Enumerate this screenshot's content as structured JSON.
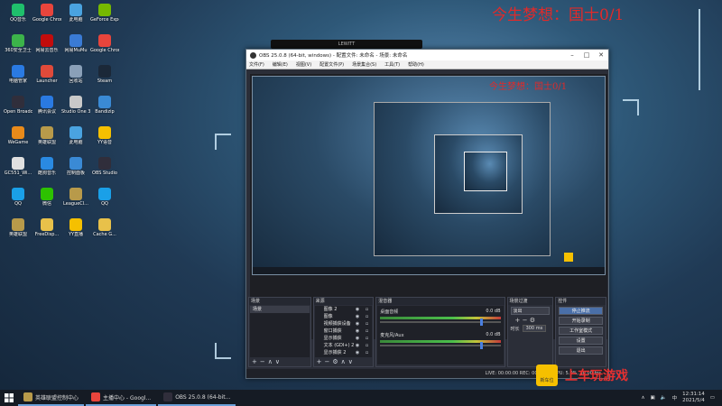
{
  "wallpaper": {
    "red_text_top": "今生梦想：国士0/1",
    "red_text_inner": "今生梦想：国士0/1",
    "chip_label": "LEWITT",
    "accent": "#e02a2a"
  },
  "desktop_icons": [
    {
      "label": "QQ音乐",
      "icon": "music-icon",
      "color": "#1fbf6c"
    },
    {
      "label": "Google Chrome",
      "icon": "chrome-icon",
      "color": "#e8453c"
    },
    {
      "label": "此电脑",
      "icon": "computer-icon",
      "color": "#4aa3e0"
    },
    {
      "label": "GeForce Experience",
      "icon": "geforce-icon",
      "color": "#76b900"
    },
    {
      "label": "360安全卫士",
      "icon": "shield-icon",
      "color": "#3cb34a"
    },
    {
      "label": "网易云音乐",
      "icon": "netease-icon",
      "color": "#c20c0c"
    },
    {
      "label": "网易MuMu",
      "icon": "mumu-icon",
      "color": "#3a7bd5"
    },
    {
      "label": "Google Chrome",
      "icon": "chrome-icon",
      "color": "#e8453c"
    },
    {
      "label": "电脑管家",
      "icon": "guard-icon",
      "color": "#2a7ae2"
    },
    {
      "label": "Launcher",
      "icon": "launcher-icon",
      "color": "#e04a3a"
    },
    {
      "label": "回收站",
      "icon": "recycle-bin-icon",
      "color": "#8aa0b8"
    },
    {
      "label": "Steam",
      "icon": "steam-icon",
      "color": "#1b2838"
    },
    {
      "label": "Open Broadcast...",
      "icon": "obs-icon",
      "color": "#302e3b"
    },
    {
      "label": "腾讯会议",
      "icon": "meeting-icon",
      "color": "#2a7ae2"
    },
    {
      "label": "Studio One 3",
      "icon": "studio-one-icon",
      "color": "#c9c9c9"
    },
    {
      "label": "Bandizip",
      "icon": "zip-icon",
      "color": "#3a8ad5"
    },
    {
      "label": "WeGame",
      "icon": "wegame-icon",
      "color": "#e88a1a"
    },
    {
      "label": "英雄联盟",
      "icon": "league-icon",
      "color": "#b89a4a"
    },
    {
      "label": "此电脑",
      "icon": "computer-icon",
      "color": "#4aa3e0"
    },
    {
      "label": "YY语音",
      "icon": "yy-icon",
      "color": "#f5c000"
    },
    {
      "label": "GC551_Wi...",
      "icon": "device-icon",
      "color": "#e0e0e0"
    },
    {
      "label": "酷狗音乐",
      "icon": "kugou-icon",
      "color": "#2a8ae2"
    },
    {
      "label": "控制面板",
      "icon": "control-panel-icon",
      "color": "#3a8ad5"
    },
    {
      "label": "OBS Studio",
      "icon": "obs-icon",
      "color": "#302e3b"
    },
    {
      "label": "QQ",
      "icon": "qq-icon",
      "color": "#1aa0e8"
    },
    {
      "label": "微信",
      "icon": "wechat-icon",
      "color": "#2dc100"
    },
    {
      "label": "LeagueCl...",
      "icon": "league-icon",
      "color": "#b89a4a"
    },
    {
      "label": "QQ",
      "icon": "qq-icon",
      "color": "#1aa0e8"
    },
    {
      "label": "英雄联盟",
      "icon": "league-icon",
      "color": "#b89a4a"
    },
    {
      "label": "FreeDisp...",
      "icon": "folder-icon",
      "color": "#e8c14a"
    },
    {
      "label": "YY直播",
      "icon": "yy-icon",
      "color": "#f5c000"
    },
    {
      "label": "Cache G...",
      "icon": "folder-icon",
      "color": "#e8c14a"
    }
  ],
  "obs": {
    "title": "OBS 25.0.8 (64-bit, windows) - 配置文件: 未命名 - 场景: 未命名",
    "menu": [
      "文件(F)",
      "编辑(E)",
      "视图(V)",
      "配置文件(P)",
      "场景集合(S)",
      "工具(T)",
      "帮助(H)"
    ],
    "docks": {
      "scenes": {
        "title": "场景",
        "items": [
          "场景"
        ]
      },
      "sources": {
        "title": "来源",
        "items": [
          "图像 2",
          "图像",
          "视频捕获设备",
          "窗口捕获",
          "显示捕获",
          "文本 (GDI+) 2",
          "显示捕获 2"
        ]
      },
      "mixer": {
        "title": "混音器",
        "channels": [
          {
            "name": "桌面音频",
            "db": "0.0 dB"
          },
          {
            "name": "麦克风/Aux",
            "db": "0.0 dB"
          }
        ]
      },
      "transitions": {
        "title": "场景过渡",
        "type": "淡出",
        "duration_label": "时长",
        "duration": "300 ms"
      },
      "controls": {
        "title": "控件",
        "buttons": [
          "停止推流",
          "开始录制",
          "工作室模式",
          "设置",
          "退出"
        ]
      }
    },
    "status": "LIVE: 00:00:00   REC: 00:00:00   CPU: 5.0%, 30.00 fps"
  },
  "watermark": {
    "logo_text": "新车位",
    "text": "上车玩游戏"
  },
  "taskbar": {
    "items": [
      {
        "label": "英雄联盟控制中心",
        "color": "#b89a4a"
      },
      {
        "label": "主播中心 - Googl...",
        "color": "#e8453c"
      },
      {
        "label": "OBS 25.0.8 (64-bit...",
        "color": "#302e3b"
      }
    ],
    "tray_lang": "中",
    "time": "12:31:14",
    "date": "2021/5/4"
  }
}
